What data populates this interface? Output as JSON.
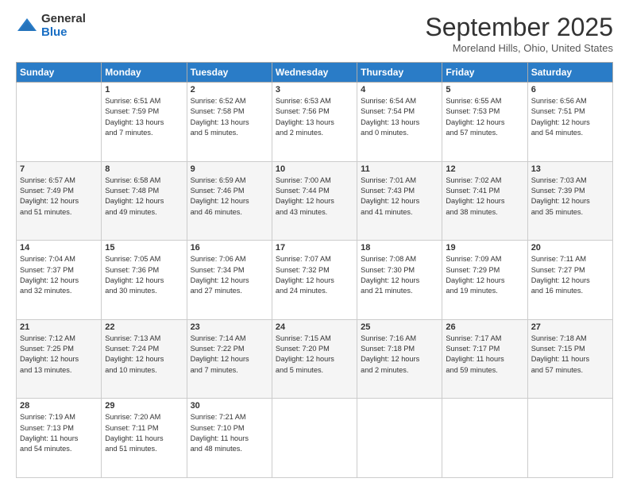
{
  "logo": {
    "general": "General",
    "blue": "Blue"
  },
  "header": {
    "month": "September 2025",
    "location": "Moreland Hills, Ohio, United States"
  },
  "days_header": [
    "Sunday",
    "Monday",
    "Tuesday",
    "Wednesday",
    "Thursday",
    "Friday",
    "Saturday"
  ],
  "weeks": [
    {
      "shaded": false,
      "days": [
        {
          "num": "",
          "info": ""
        },
        {
          "num": "1",
          "info": "Sunrise: 6:51 AM\nSunset: 7:59 PM\nDaylight: 13 hours\nand 7 minutes."
        },
        {
          "num": "2",
          "info": "Sunrise: 6:52 AM\nSunset: 7:58 PM\nDaylight: 13 hours\nand 5 minutes."
        },
        {
          "num": "3",
          "info": "Sunrise: 6:53 AM\nSunset: 7:56 PM\nDaylight: 13 hours\nand 2 minutes."
        },
        {
          "num": "4",
          "info": "Sunrise: 6:54 AM\nSunset: 7:54 PM\nDaylight: 13 hours\nand 0 minutes."
        },
        {
          "num": "5",
          "info": "Sunrise: 6:55 AM\nSunset: 7:53 PM\nDaylight: 12 hours\nand 57 minutes."
        },
        {
          "num": "6",
          "info": "Sunrise: 6:56 AM\nSunset: 7:51 PM\nDaylight: 12 hours\nand 54 minutes."
        }
      ]
    },
    {
      "shaded": true,
      "days": [
        {
          "num": "7",
          "info": "Sunrise: 6:57 AM\nSunset: 7:49 PM\nDaylight: 12 hours\nand 51 minutes."
        },
        {
          "num": "8",
          "info": "Sunrise: 6:58 AM\nSunset: 7:48 PM\nDaylight: 12 hours\nand 49 minutes."
        },
        {
          "num": "9",
          "info": "Sunrise: 6:59 AM\nSunset: 7:46 PM\nDaylight: 12 hours\nand 46 minutes."
        },
        {
          "num": "10",
          "info": "Sunrise: 7:00 AM\nSunset: 7:44 PM\nDaylight: 12 hours\nand 43 minutes."
        },
        {
          "num": "11",
          "info": "Sunrise: 7:01 AM\nSunset: 7:43 PM\nDaylight: 12 hours\nand 41 minutes."
        },
        {
          "num": "12",
          "info": "Sunrise: 7:02 AM\nSunset: 7:41 PM\nDaylight: 12 hours\nand 38 minutes."
        },
        {
          "num": "13",
          "info": "Sunrise: 7:03 AM\nSunset: 7:39 PM\nDaylight: 12 hours\nand 35 minutes."
        }
      ]
    },
    {
      "shaded": false,
      "days": [
        {
          "num": "14",
          "info": "Sunrise: 7:04 AM\nSunset: 7:37 PM\nDaylight: 12 hours\nand 32 minutes."
        },
        {
          "num": "15",
          "info": "Sunrise: 7:05 AM\nSunset: 7:36 PM\nDaylight: 12 hours\nand 30 minutes."
        },
        {
          "num": "16",
          "info": "Sunrise: 7:06 AM\nSunset: 7:34 PM\nDaylight: 12 hours\nand 27 minutes."
        },
        {
          "num": "17",
          "info": "Sunrise: 7:07 AM\nSunset: 7:32 PM\nDaylight: 12 hours\nand 24 minutes."
        },
        {
          "num": "18",
          "info": "Sunrise: 7:08 AM\nSunset: 7:30 PM\nDaylight: 12 hours\nand 21 minutes."
        },
        {
          "num": "19",
          "info": "Sunrise: 7:09 AM\nSunset: 7:29 PM\nDaylight: 12 hours\nand 19 minutes."
        },
        {
          "num": "20",
          "info": "Sunrise: 7:11 AM\nSunset: 7:27 PM\nDaylight: 12 hours\nand 16 minutes."
        }
      ]
    },
    {
      "shaded": true,
      "days": [
        {
          "num": "21",
          "info": "Sunrise: 7:12 AM\nSunset: 7:25 PM\nDaylight: 12 hours\nand 13 minutes."
        },
        {
          "num": "22",
          "info": "Sunrise: 7:13 AM\nSunset: 7:24 PM\nDaylight: 12 hours\nand 10 minutes."
        },
        {
          "num": "23",
          "info": "Sunrise: 7:14 AM\nSunset: 7:22 PM\nDaylight: 12 hours\nand 7 minutes."
        },
        {
          "num": "24",
          "info": "Sunrise: 7:15 AM\nSunset: 7:20 PM\nDaylight: 12 hours\nand 5 minutes."
        },
        {
          "num": "25",
          "info": "Sunrise: 7:16 AM\nSunset: 7:18 PM\nDaylight: 12 hours\nand 2 minutes."
        },
        {
          "num": "26",
          "info": "Sunrise: 7:17 AM\nSunset: 7:17 PM\nDaylight: 11 hours\nand 59 minutes."
        },
        {
          "num": "27",
          "info": "Sunrise: 7:18 AM\nSunset: 7:15 PM\nDaylight: 11 hours\nand 57 minutes."
        }
      ]
    },
    {
      "shaded": false,
      "days": [
        {
          "num": "28",
          "info": "Sunrise: 7:19 AM\nSunset: 7:13 PM\nDaylight: 11 hours\nand 54 minutes."
        },
        {
          "num": "29",
          "info": "Sunrise: 7:20 AM\nSunset: 7:11 PM\nDaylight: 11 hours\nand 51 minutes."
        },
        {
          "num": "30",
          "info": "Sunrise: 7:21 AM\nSunset: 7:10 PM\nDaylight: 11 hours\nand 48 minutes."
        },
        {
          "num": "",
          "info": ""
        },
        {
          "num": "",
          "info": ""
        },
        {
          "num": "",
          "info": ""
        },
        {
          "num": "",
          "info": ""
        }
      ]
    }
  ]
}
